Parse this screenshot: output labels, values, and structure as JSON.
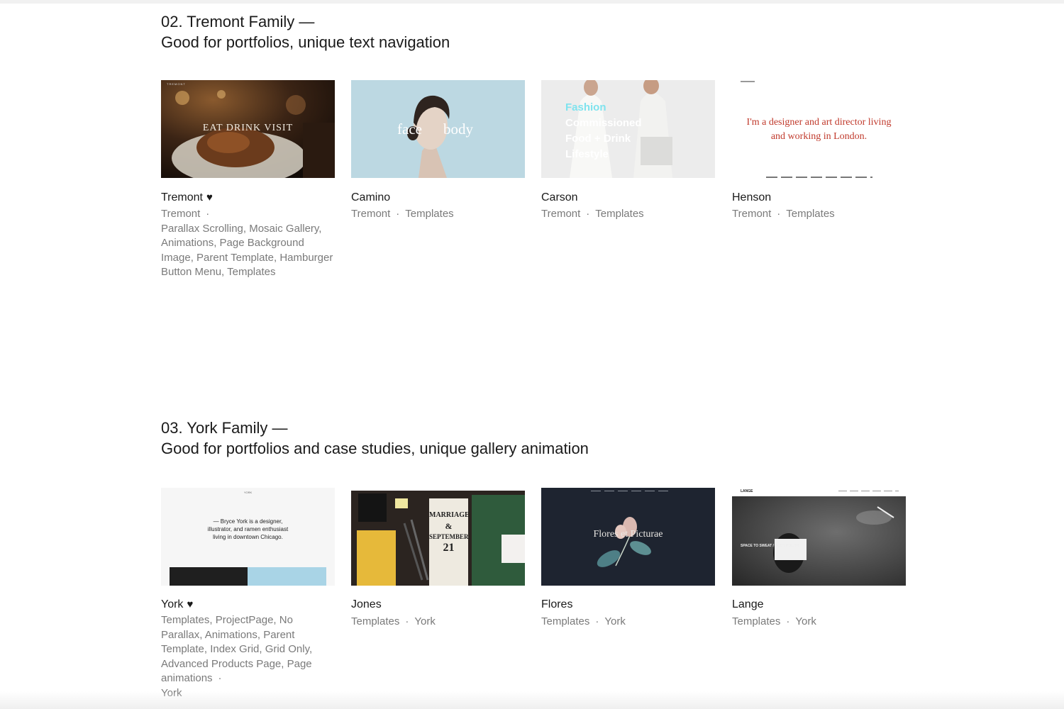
{
  "sections": [
    {
      "title": "02. Tremont Family —",
      "subtitle": "Good for portfolios, unique text navigation",
      "cards": [
        {
          "name": "Tremont",
          "heart": "♥",
          "family": "Tremont",
          "sep": "·",
          "tags": "Parallax Scrolling, Mosaic Gallery, Animations, Page Background Image, Parent Template, Hamburger Button Menu, Templates",
          "thumb_text": "EAT  DRINK  VISIT",
          "thumb_brand": "TREMONT"
        },
        {
          "name": "Camino",
          "family": "Tremont",
          "sep": "·",
          "category": "Templates",
          "thumb_text_left": "face",
          "thumb_text_right": "body"
        },
        {
          "name": "Carson",
          "family": "Tremont",
          "sep": "·",
          "category": "Templates",
          "thumb_lines": [
            "Fashion",
            "Commissioned",
            "Food + Drink",
            "Lifestyle"
          ]
        },
        {
          "name": "Henson",
          "family": "Tremont",
          "sep": "·",
          "category": "Templates",
          "thumb_lines": [
            "I'm a designer and art director living",
            "and working in London."
          ]
        }
      ]
    },
    {
      "title": "03. York Family —",
      "subtitle": "Good for portfolios and case studies, unique gallery animation",
      "cards": [
        {
          "name": "York",
          "heart": "♥",
          "tags": "Templates, ProjectPage, No Parallax, Animations, Parent Template, Index Grid, Grid Only, Advanced Products Page, Page animations",
          "sep": "·",
          "family": "York",
          "thumb_lines": [
            "— Bryce York is a designer,",
            "illustrator, and ramen enthusiast",
            "living in downtown Chicago."
          ],
          "thumb_brand": "YORK"
        },
        {
          "name": "Jones",
          "category": "Templates",
          "sep": "·",
          "family": "York",
          "thumb_lines": [
            "MARRIAGE",
            "&",
            "SEPTEMBER",
            "21"
          ]
        },
        {
          "name": "Flores",
          "category": "Templates",
          "sep": "·",
          "family": "York",
          "thumb_text": "Flores et Picturae"
        },
        {
          "name": "Lange",
          "category": "Templates",
          "sep": "·",
          "family": "York",
          "thumb_text": "SPACE TO SWEAT / BODY POLITIC",
          "thumb_brand": "LANGE"
        }
      ]
    }
  ],
  "colors": {
    "text": "#1a1a1a",
    "meta": "#7a7a7a",
    "henson_red": "#c0392b",
    "carson_cyan": "#7fe3ee",
    "york_blue": "#a9d4e6"
  }
}
